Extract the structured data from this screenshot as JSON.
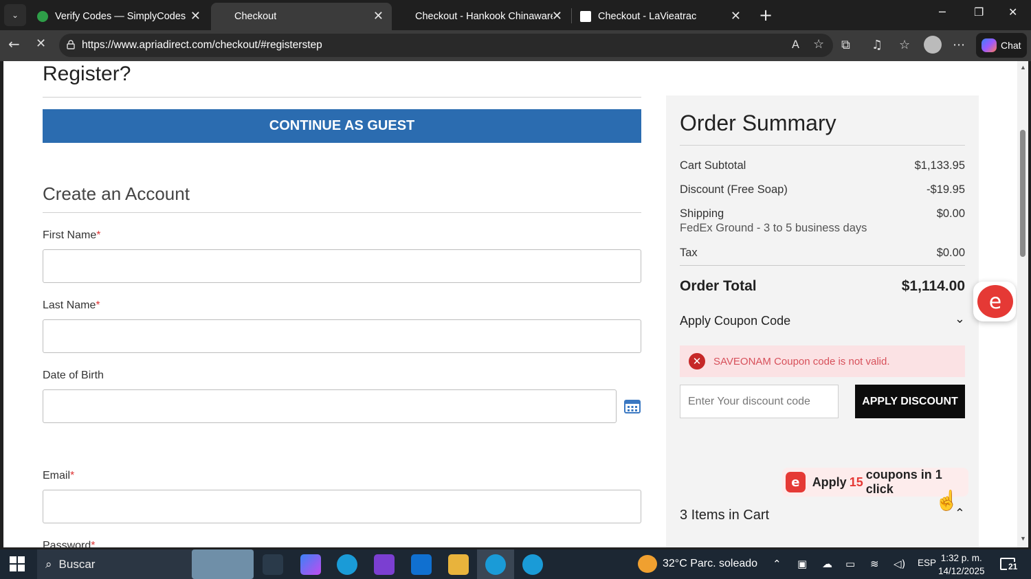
{
  "browser": {
    "tabs": [
      {
        "title": "Verify Codes — SimplyCodes",
        "active": false
      },
      {
        "title": "Checkout",
        "active": true
      },
      {
        "title": "Checkout - Hankook Chinaware US",
        "active": false
      },
      {
        "title": "Checkout - LaVieatrac",
        "active": false
      }
    ],
    "url": "https://www.apriadirect.com/checkout/#registerstep",
    "chat_label": "Chat"
  },
  "checkout": {
    "register_heading": "Register?",
    "guest_button": "CONTINUE AS GUEST",
    "create_heading": "Create an Account",
    "fields": {
      "first_name": "First Name",
      "last_name": "Last Name",
      "dob": "Date of Birth",
      "email": "Email",
      "password": "Password"
    },
    "required_mark": "*"
  },
  "summary": {
    "title": "Order Summary",
    "subtotal_label": "Cart Subtotal",
    "subtotal_value": "$1,133.95",
    "discount_label": "Discount (Free Soap)",
    "discount_value": "-$19.95",
    "shipping_label": "Shipping",
    "shipping_value": "$0.00",
    "shipping_method": "FedEx Ground - 3 to 5 business days",
    "tax_label": "Tax",
    "tax_value": "$0.00",
    "total_label": "Order Total",
    "total_value": "$1,114.00",
    "coupon_heading": "Apply Coupon Code",
    "error_message": "SAVEONAM Coupon code is not valid.",
    "discount_placeholder": "Enter Your discount code",
    "apply_button": "APPLY DISCOUNT",
    "cart_heading": "3 Items in Cart"
  },
  "promo": {
    "text_before": "Apply",
    "count": "15",
    "text_after": "coupons in 1 click"
  },
  "taskbar": {
    "search_label": "Buscar",
    "weather": "32°C  Parc. soleado",
    "language": "ESP",
    "time": "1:32 p. m.",
    "date": "14/12/2025",
    "notifications": "21"
  }
}
